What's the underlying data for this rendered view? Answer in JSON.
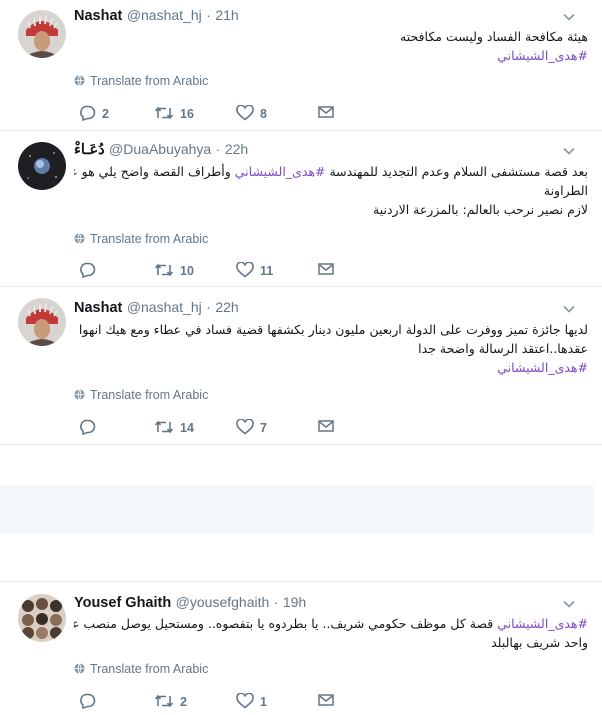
{
  "colors": {
    "hashtag": "#794bc4",
    "secondary_text": "#657786",
    "divider": "#e6ecf0"
  },
  "translate_label": "Translate from Arabic",
  "icons": {
    "reply": "reply-icon",
    "retweet": "retweet-icon",
    "like": "heart-icon",
    "dm": "direct-message-icon",
    "translate": "globe-icon",
    "menu": "chevron-down-icon"
  },
  "tweets": [
    {
      "name": "Nashat",
      "handle": "@nashat_hj",
      "dot": "·",
      "time": "21h",
      "lines": [
        {
          "pre": "هيئة مكافحة الفساد وليست مكافحته",
          "tag": "",
          "post": ""
        },
        {
          "pre": "",
          "tag": "#هدى_الشيشاني",
          "post": ""
        }
      ],
      "replies": "2",
      "retweets": "16",
      "likes": "8"
    },
    {
      "name": "دُعَـاءْ",
      "handle": "@DuaAbuyahya",
      "dot": "·",
      "time": "22h",
      "lines": [
        {
          "pre": "بعد قصة مستشفى السلام وعدم التجديد للمهندسة ",
          "tag": "#هدى_الشيشاني",
          "post": " وأطراف القصة واضح يلي هو عاطف"
        },
        {
          "pre": "الطراونة",
          "tag": "",
          "post": ""
        },
        {
          "pre": "لازم نصير نرحب بالعالم: بالمزرعة الاردنية",
          "tag": "",
          "post": ""
        }
      ],
      "replies": "",
      "retweets": "10",
      "likes": "11"
    },
    {
      "name": "Nashat",
      "handle": "@nashat_hj",
      "dot": "·",
      "time": "22h",
      "lines": [
        {
          "pre": "لديها جائزة تميز ووفرت على الدولة اربعين مليون دينار بكشفها قضية فساد في عطاء ومع هيك انهوا",
          "tag": "",
          "post": ""
        },
        {
          "pre": "عقدها..اعتقد الرسالة واضحة جدا",
          "tag": "",
          "post": ""
        },
        {
          "pre": "",
          "tag": "#هدى_الشيشاني",
          "post": ""
        }
      ],
      "replies": "",
      "retweets": "14",
      "likes": "7"
    },
    {
      "name": "Yousef Ghaith",
      "handle": "@yousefghaith",
      "dot": "·",
      "time": "19h",
      "lines": [
        {
          "pre": "",
          "tag": "#هدى_الشيشاني",
          "post": " قصة كل موظف حكومي شريف.. يا بطردوه يا بتفصوه.. ومستحيل يوصل منصب عالي"
        },
        {
          "pre": "واحد شريف بهالبلد",
          "tag": "",
          "post": ""
        }
      ],
      "replies": "",
      "retweets": "2",
      "likes": "1"
    }
  ]
}
